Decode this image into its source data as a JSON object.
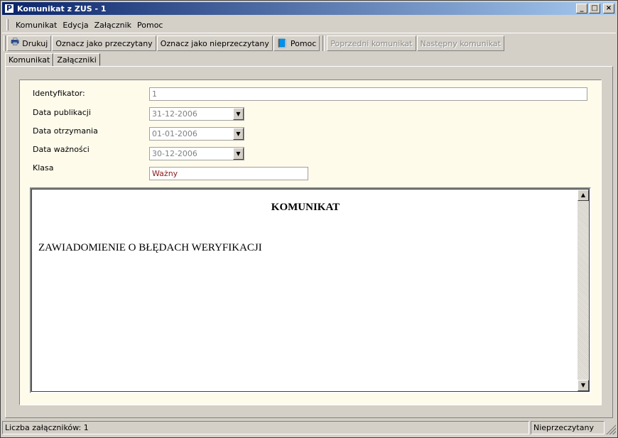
{
  "window": {
    "title": "Komunikat z ZUS - 1",
    "app_icon": "P",
    "controls": {
      "minimize": "_",
      "maximize": "□",
      "close": "×"
    }
  },
  "menu": {
    "items": [
      {
        "label": "Komunikat"
      },
      {
        "label": "Edycja"
      },
      {
        "label": "Załącznik"
      },
      {
        "label": "Pomoc"
      }
    ]
  },
  "toolbar": {
    "print": {
      "label": "Drukuj",
      "icon": "printer-icon",
      "glyph": "🖶"
    },
    "mark_read": {
      "label": "Oznacz jako przeczytany"
    },
    "mark_unread": {
      "label": "Oznacz jako nieprzeczytany"
    },
    "help": {
      "label": "Pomoc",
      "icon": "help-book-icon",
      "glyph": "📘"
    },
    "previous": {
      "label": "Poprzedni komunikat",
      "enabled": false
    },
    "next": {
      "label": "Następny komunikat",
      "enabled": false
    }
  },
  "tabs": [
    {
      "label": "Komunikat",
      "active": true
    },
    {
      "label": "Załączniki",
      "active": false
    }
  ],
  "form": {
    "identifier": {
      "label": "Identyfikator:",
      "value": "1"
    },
    "publication_date": {
      "label": "Data publikacji",
      "value": "31-12-2006"
    },
    "received_date": {
      "label": "Data otrzymania",
      "value": "01-01-2006"
    },
    "expiry_date": {
      "label": "Data ważności",
      "value": "30-12-2006"
    },
    "class": {
      "label": "Klasa",
      "value": "Ważny"
    }
  },
  "message": {
    "heading": "KOMUNIKAT",
    "body": "ZAWIADOMIENIE O BŁĘDACH WERYFIKACJI"
  },
  "statusbar": {
    "attachments": "Liczba załączników: 1",
    "state": "Nieprzeczytany"
  },
  "colors": {
    "title_bar_start": "#0a246a",
    "title_bar_end": "#a6caf0",
    "panel_background": "#fefbeb",
    "class_value": "#8b1a1a"
  }
}
